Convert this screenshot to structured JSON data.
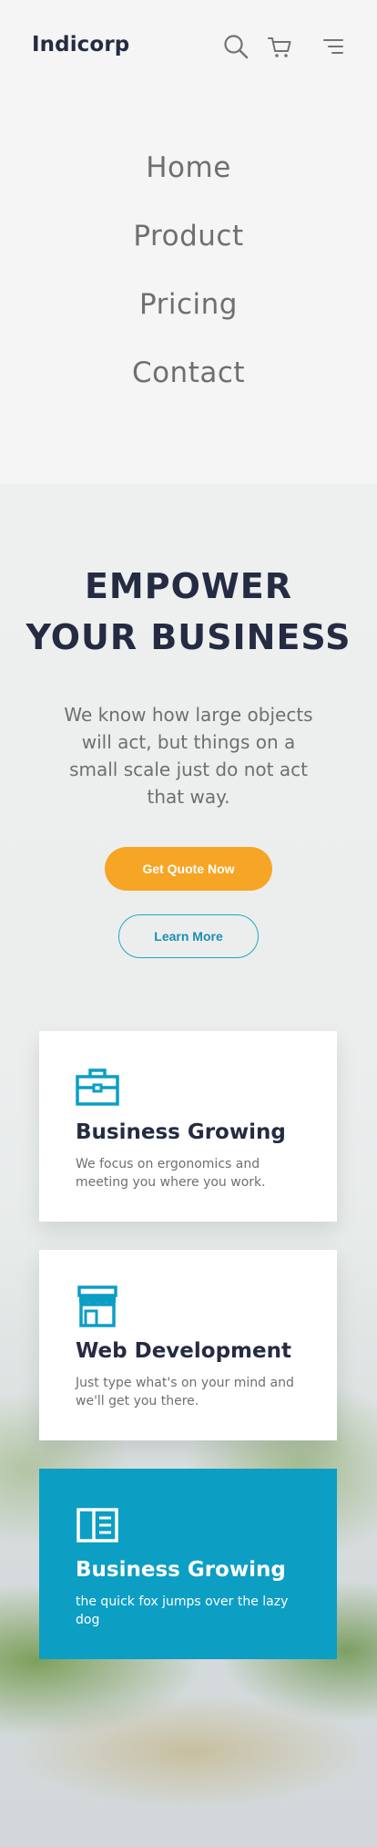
{
  "header": {
    "logo": "Indicorp",
    "icons": [
      "search-icon",
      "cart-icon",
      "menu-icon"
    ]
  },
  "nav": {
    "items": [
      {
        "label": "Home"
      },
      {
        "label": "Product"
      },
      {
        "label": "Pricing"
      },
      {
        "label": "Contact"
      }
    ]
  },
  "hero": {
    "title_line1": "EMPOWER",
    "title_line2": "YOUR BUSINESS",
    "description": "We know how large objects will act, but things on a small scale just do not act that way.",
    "primary_button": "Get Quote Now",
    "secondary_button": "Learn More"
  },
  "features": [
    {
      "icon": "briefcase-icon",
      "title": "Business Growing",
      "text": "We focus on ergonomics and meeting you where you work."
    },
    {
      "icon": "storefront-icon",
      "title": "Web Development",
      "text": "Just type what's on your mind and we'll get you there."
    },
    {
      "icon": "book-open-icon",
      "title": "Business Growing",
      "text": "the quick fox jumps over the lazy dog"
    }
  ],
  "colors": {
    "primary_dark": "#252b42",
    "accent_orange": "#f7a525",
    "accent_blue": "#0d9ec4",
    "text_muted": "#6f6f6f"
  }
}
